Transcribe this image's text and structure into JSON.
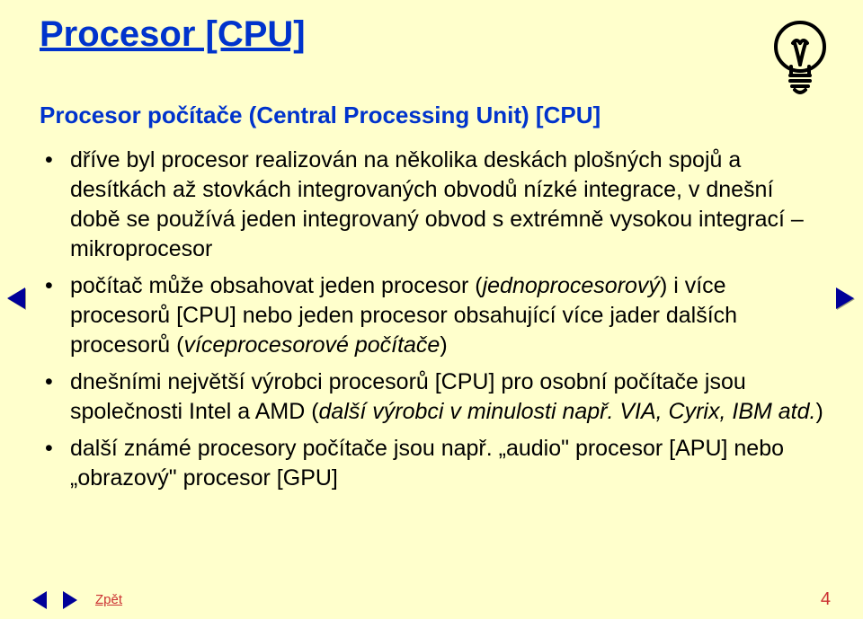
{
  "title": "Procesor [CPU]",
  "subtitle": "Procesor počítače (Central Processing Unit) [CPU]",
  "bullets": [
    {
      "parts": [
        {
          "text": "dříve byl procesor realizován na několika deskách plošných spojů a desítkách až stovkách integrovaných obvodů nízké integrace, v dnešní době se používá jeden integrovaný obvod s extrémně vysokou integrací – mikroprocesor",
          "italic": false
        }
      ]
    },
    {
      "parts": [
        {
          "text": "počítač může obsahovat jeden procesor (",
          "italic": false
        },
        {
          "text": "jednoprocesorový",
          "italic": true
        },
        {
          "text": ") i více procesorů [CPU] nebo jeden procesor obsahující více jader dalších procesorů (",
          "italic": false
        },
        {
          "text": "víceprocesorové počítače",
          "italic": true
        },
        {
          "text": ")",
          "italic": false
        }
      ]
    },
    {
      "parts": [
        {
          "text": "dnešními největší výrobci procesorů [CPU] pro osobní počítače jsou společnosti Intel a AMD (",
          "italic": false
        },
        {
          "text": "další výrobci v minulosti např. VIA, Cyrix, IBM atd.",
          "italic": true
        },
        {
          "text": ")",
          "italic": false
        }
      ]
    },
    {
      "parts": [
        {
          "text": "další známé procesory počítače jsou např. „audio\" procesor [APU] nebo „obrazový\" procesor [GPU]",
          "italic": false
        }
      ]
    }
  ],
  "footer": {
    "back_label": "Zpět",
    "page_number": "4"
  }
}
